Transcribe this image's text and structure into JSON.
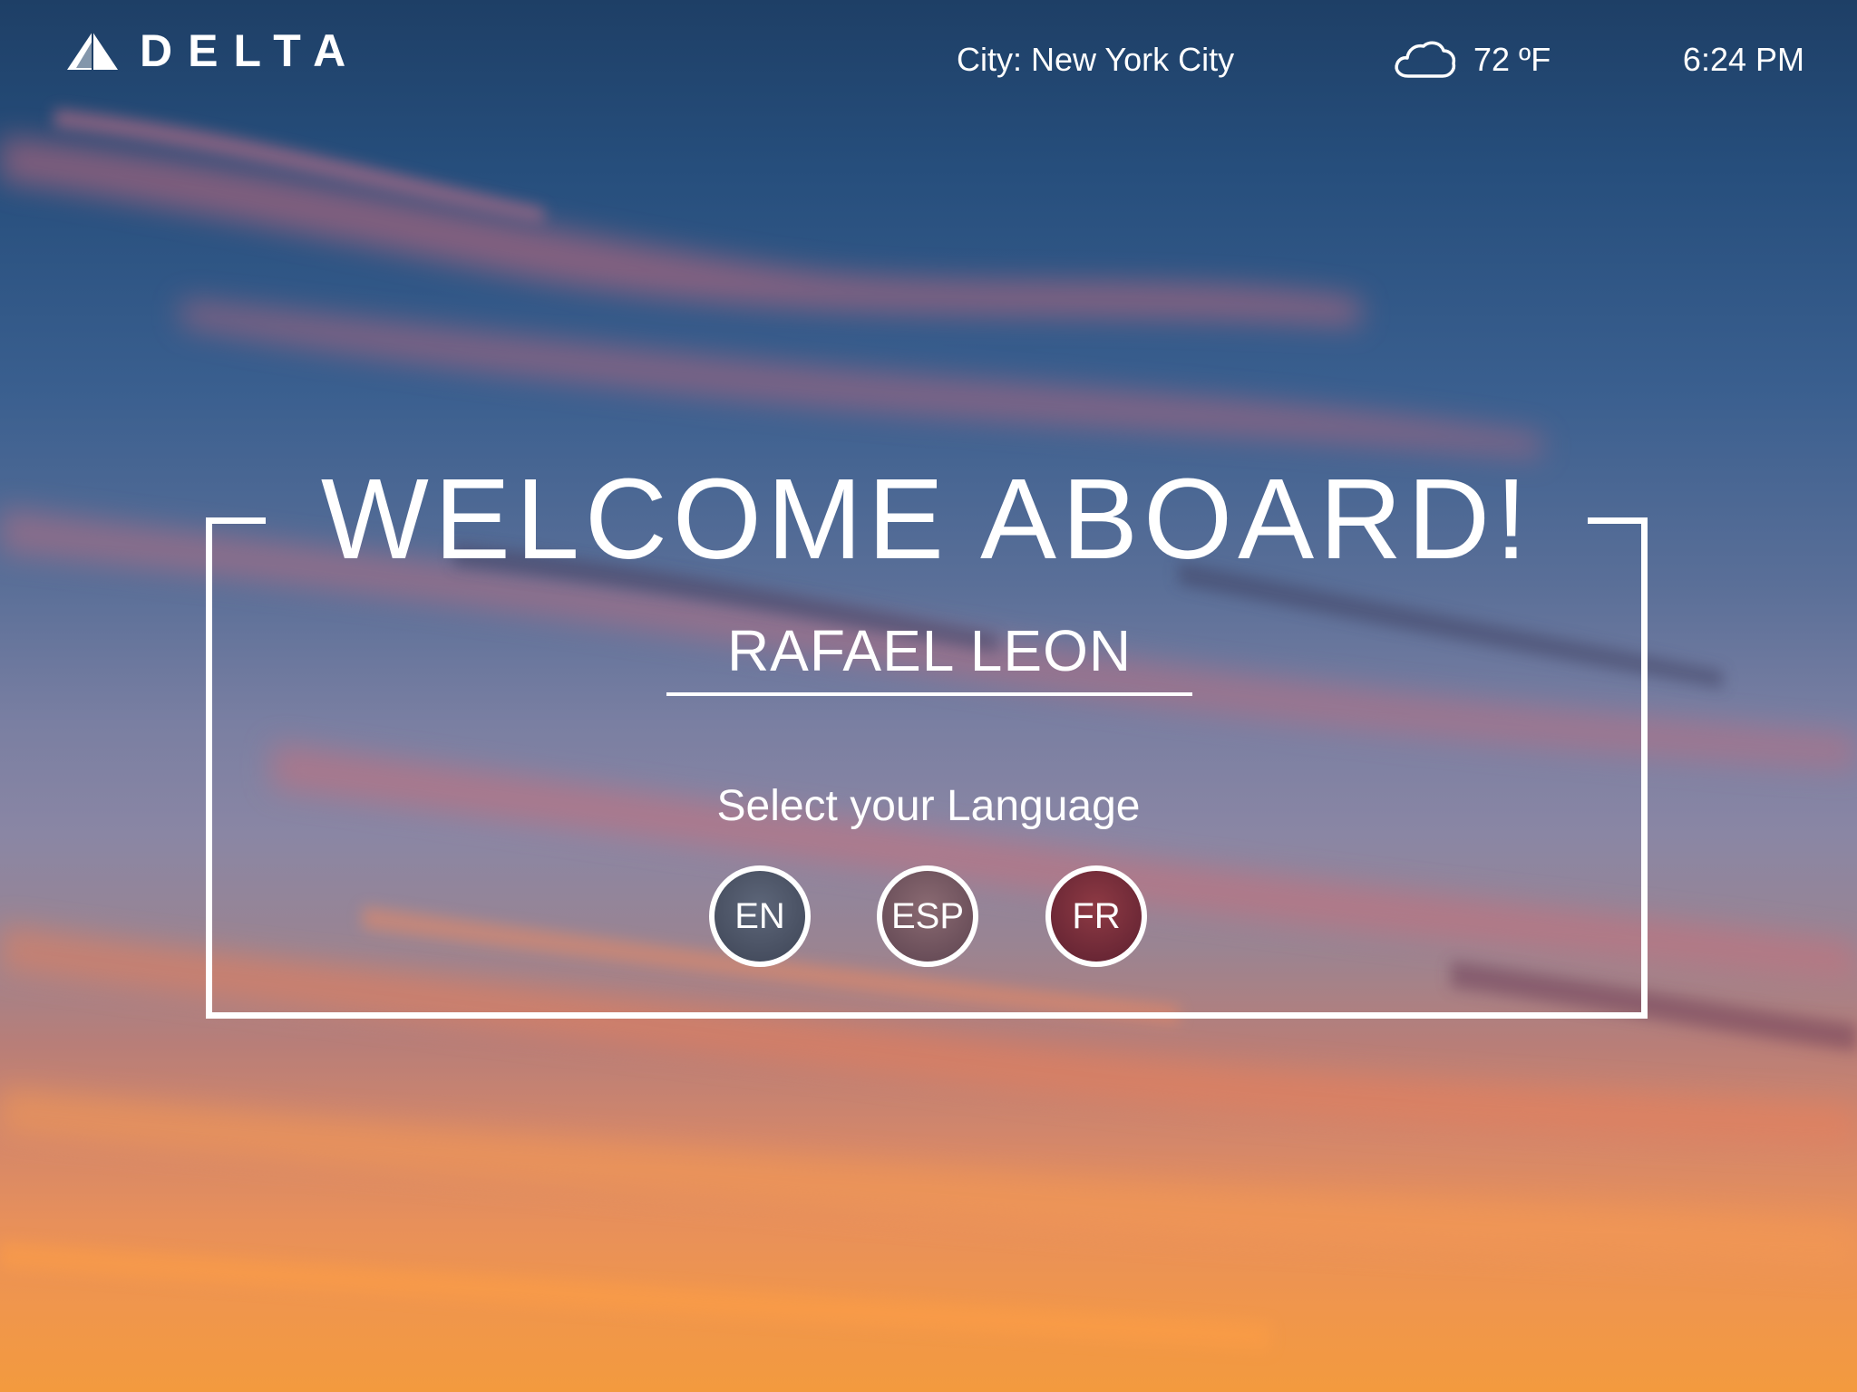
{
  "brand": {
    "name": "DELTA",
    "logo_icon": "delta-widget-icon"
  },
  "header": {
    "city": "City: New York City",
    "weather_icon": "cloud-icon",
    "temperature": "72 ºF",
    "time": "6:24 PM"
  },
  "welcome": {
    "title": "WELCOME ABOARD!",
    "passenger_name": "RAFAEL LEON",
    "language_prompt": "Select your Language",
    "languages": [
      {
        "code": "EN"
      },
      {
        "code": "ESP"
      },
      {
        "code": "FR"
      }
    ]
  },
  "colors": {
    "text": "#ffffff",
    "sky_top": "#1e3f66",
    "sky_bottom": "#f39a3e"
  }
}
